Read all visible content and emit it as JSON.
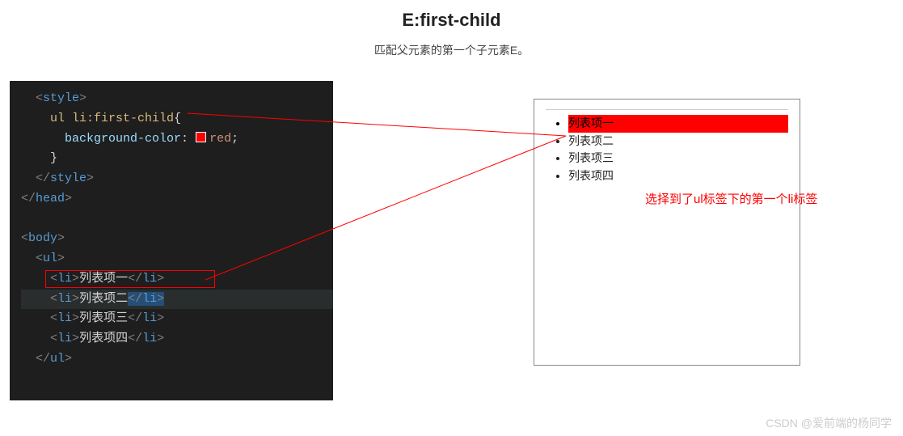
{
  "title": "E:first-child",
  "subtitle": "匹配父元素的第一个子元素E。",
  "code": {
    "style_open": "<style>",
    "selector_el": "ul li",
    "selector_pseudo": ":first-child",
    "brace_open": "{",
    "prop": "background-color",
    "colon": ":",
    "val": "red",
    "semicolon": ";",
    "brace_close": "}",
    "style_close": "</style>",
    "head_close": "</head>",
    "body_open": "<body>",
    "ul_open": "<ul>",
    "li_open": "<li>",
    "li_close": "</li>",
    "item1": "列表项一",
    "item2": "列表项二",
    "item3": "列表项三",
    "item4": "列表项四",
    "ul_close": "</ul>"
  },
  "preview": {
    "items": [
      "列表项一",
      "列表项二",
      "列表项三",
      "列表项四"
    ]
  },
  "annotation": "选择到了ul标签下的第一个li标签",
  "watermark": "CSDN @爱前端的杨同学",
  "colors": {
    "highlight_bg": "#ff0000",
    "code_bg": "#1e1e1e"
  }
}
